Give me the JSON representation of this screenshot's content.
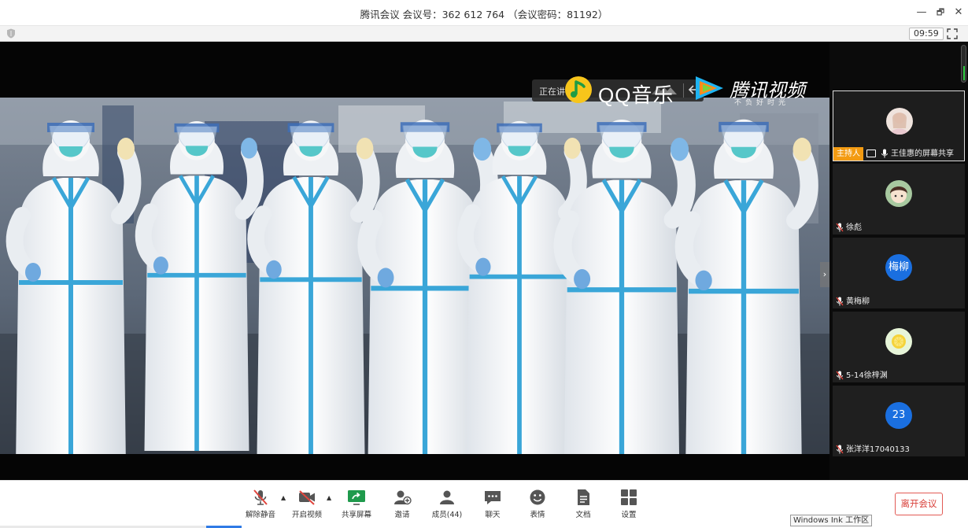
{
  "window": {
    "title": "腾讯会议 会议号：362 612 764 （会议密码：81192）",
    "controls": {
      "minimize": "—",
      "restore": "🗗",
      "close": "✕"
    }
  },
  "subbar": {
    "timer": "09:59"
  },
  "stage": {
    "speaking_label": "正在讲话:",
    "watermarks": {
      "qq_music": "QQ音乐",
      "tencent_video": "腾讯视频",
      "tencent_video_slogan": "不负好时光"
    },
    "side_arrow": "›"
  },
  "participants": [
    {
      "name": "王佳惠的屏幕共享",
      "host_badge": "主持人",
      "avatar_text": "",
      "avatar_color": "#e8d6d0",
      "active": true
    },
    {
      "name": "徐彪",
      "avatar_text": "",
      "avatar_color": "#9fc39a"
    },
    {
      "name": "黄梅柳",
      "avatar_text": "梅柳",
      "avatar_color": "#1a6fe0"
    },
    {
      "name": "5-14徐梓渊",
      "avatar_text": "",
      "avatar_color": "#dff3c8"
    },
    {
      "name": "张洋洋17040133",
      "avatar_text": "23",
      "avatar_color": "#1a6fe0"
    }
  ],
  "toolbar": {
    "unmute": "解除静音",
    "start_video": "开启视频",
    "share_screen": "共享屏幕",
    "invite": "邀请",
    "members": "成员(44)",
    "chat": "聊天",
    "reactions": "表情",
    "docs": "文档",
    "settings": "设置",
    "leave": "离开会议",
    "caret": "▲"
  },
  "taskbar_tooltip": "Windows Ink 工作区",
  "colors": {
    "accent": "#2f7ae5",
    "host_badge": "#f39b12",
    "leave": "#d9403a",
    "mic_off": "#e0453d"
  }
}
